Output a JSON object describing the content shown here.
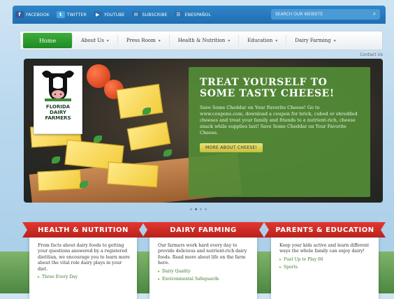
{
  "social": [
    {
      "label": "FACEBOOK",
      "icon": "facebook-icon",
      "color": "#3b5998",
      "glyph": "f"
    },
    {
      "label": "TWITTER",
      "icon": "twitter-icon",
      "color": "#4aa3df",
      "glyph": "t"
    },
    {
      "label": "YOUTUBE",
      "icon": "youtube-icon",
      "color": "#2a6fb0",
      "glyph": "▶"
    },
    {
      "label": "SUBSCRIBE",
      "icon": "mail-icon",
      "color": "#2a6fb0",
      "glyph": "✉"
    },
    {
      "label": "ENESPAÑOL",
      "icon": "spanish-icon",
      "color": "#2a6fb0",
      "glyph": "☰"
    }
  ],
  "search": {
    "placeholder": "SEARCH OUR WEBSITE"
  },
  "nav": {
    "home": "Home",
    "items": [
      "About Us",
      "Press Room",
      "Health & Nutrition",
      "Education",
      "Dairy Farming"
    ]
  },
  "contact": "Contact Us",
  "logo": {
    "line1": "FLORIDA",
    "line2": "DAIRY",
    "line3": "FARMERS"
  },
  "promo": {
    "title": "TREAT YOURSELF TO SOME TASTY CHEESE!",
    "body": "Save Some Cheddar on Your Favorite Cheese! Go to www.coupons.com, download a coupon for brick, cubed or shredded cheeses and treat your family and friends to a nutrient-rich, cheese snack while supplies last! Save Some Cheddar on Your Favorite Cheese.",
    "button": "MORE ABOUT CHEESE!"
  },
  "cards": [
    {
      "title": "HEALTH & NUTRITION",
      "body": "From facts about dairy foods to getting your questions answered by a registered dietitian, we encourage you to learn more about the vital role dairy plays in your diet.",
      "links": [
        "Three Every Day"
      ]
    },
    {
      "title": "DAIRY FARMING",
      "body": "Our farmers work hard every day to provide delicious and nutrient-rich dairy foods. Read more about life on the farm here.",
      "links": [
        "Dairy Quality",
        "Environmental Safeguards"
      ]
    },
    {
      "title": "PARENTS & EDUCATION",
      "body": "Keep your kids active and learn different ways the whole family can enjoy dairy!",
      "links": [
        "Fuel Up to Play 60",
        "Sports"
      ]
    }
  ]
}
